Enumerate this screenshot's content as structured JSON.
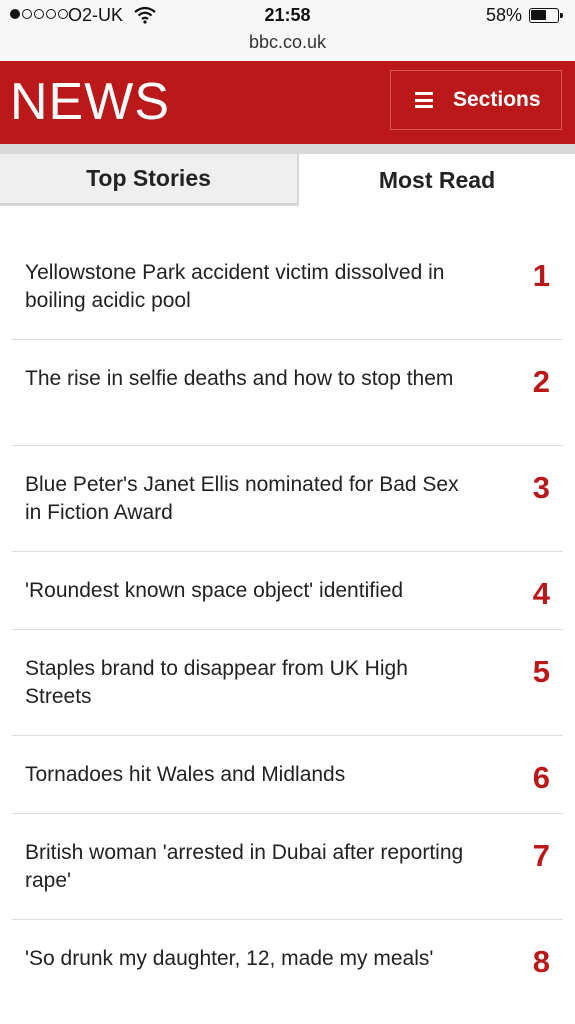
{
  "status_bar": {
    "carrier": "O2-UK",
    "time": "21:58",
    "battery": "58%",
    "battery_level": 0.58
  },
  "browser": {
    "url": "bbc.co.uk"
  },
  "header": {
    "logo": "NEWS",
    "sections_label": "Sections",
    "brand_color": "#bb1919"
  },
  "tabs": [
    {
      "label": "Top Stories",
      "active": false
    },
    {
      "label": "Most Read",
      "active": true
    }
  ],
  "stories": [
    {
      "rank": "1",
      "title": "Yellowstone Park accident victim dissolved in boiling acidic pool"
    },
    {
      "rank": "2",
      "title": "The rise in selfie deaths and how to stop them"
    },
    {
      "rank": "3",
      "title": "Blue Peter's Janet Ellis nominated for Bad Sex in Fiction Award"
    },
    {
      "rank": "4",
      "title": "'Roundest known space object' identified"
    },
    {
      "rank": "5",
      "title": "Staples brand to disappear from UK High Streets"
    },
    {
      "rank": "6",
      "title": "Tornadoes hit Wales and Midlands"
    },
    {
      "rank": "7",
      "title": "British woman 'arrested in Dubai after reporting rape'"
    },
    {
      "rank": "8",
      "title": "'So drunk my daughter, 12, made my meals'"
    }
  ]
}
